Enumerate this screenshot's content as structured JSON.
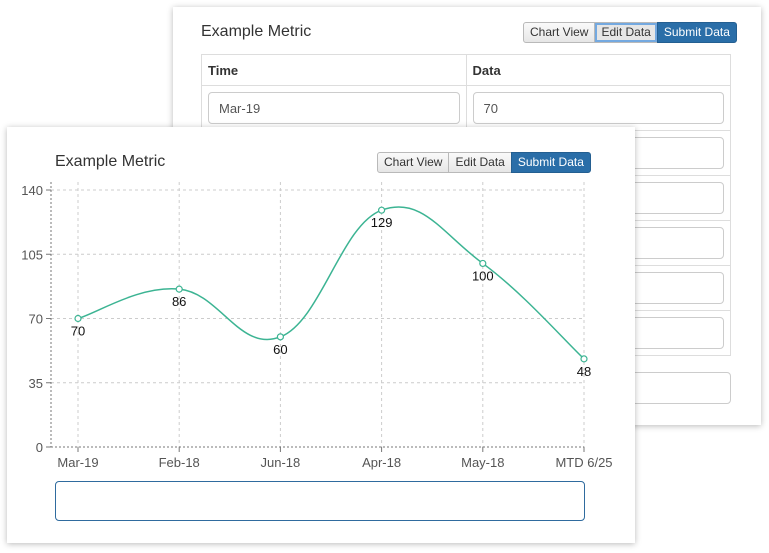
{
  "back_panel": {
    "title": "Example Metric",
    "buttons": {
      "chart_view": "Chart View",
      "edit_data": "Edit Data",
      "submit_data": "Submit Data"
    },
    "table": {
      "headers": [
        "Time",
        "Data"
      ],
      "rows": [
        {
          "time": "Mar-19",
          "data": "70"
        },
        {
          "time": "",
          "data": ""
        },
        {
          "time": "",
          "data": ""
        },
        {
          "time": "",
          "data": ""
        },
        {
          "time": "",
          "data": ""
        },
        {
          "time": "",
          "data": ""
        }
      ]
    }
  },
  "front_panel": {
    "title": "Example Metric",
    "buttons": {
      "chart_view": "Chart View",
      "edit_data": "Edit Data",
      "submit_data": "Submit Data"
    },
    "input_value": ""
  },
  "colors": {
    "line": "#3cb493",
    "grid": "#cccccc",
    "primary_button": "#2a6ea8"
  },
  "chart_data": {
    "type": "line",
    "categories": [
      "Mar-19",
      "Feb-18",
      "Jun-18",
      "Apr-18",
      "May-18",
      "MTD 6/25"
    ],
    "values": [
      70,
      86,
      60,
      129,
      100,
      48
    ],
    "data_labels": [
      "70",
      "86",
      "60",
      "129",
      "100",
      "48"
    ],
    "yticks": [
      0,
      35,
      70,
      105,
      140
    ],
    "ylim": [
      0,
      140
    ],
    "grid": true,
    "curve": "smooth",
    "markers": "hollow-circle"
  }
}
